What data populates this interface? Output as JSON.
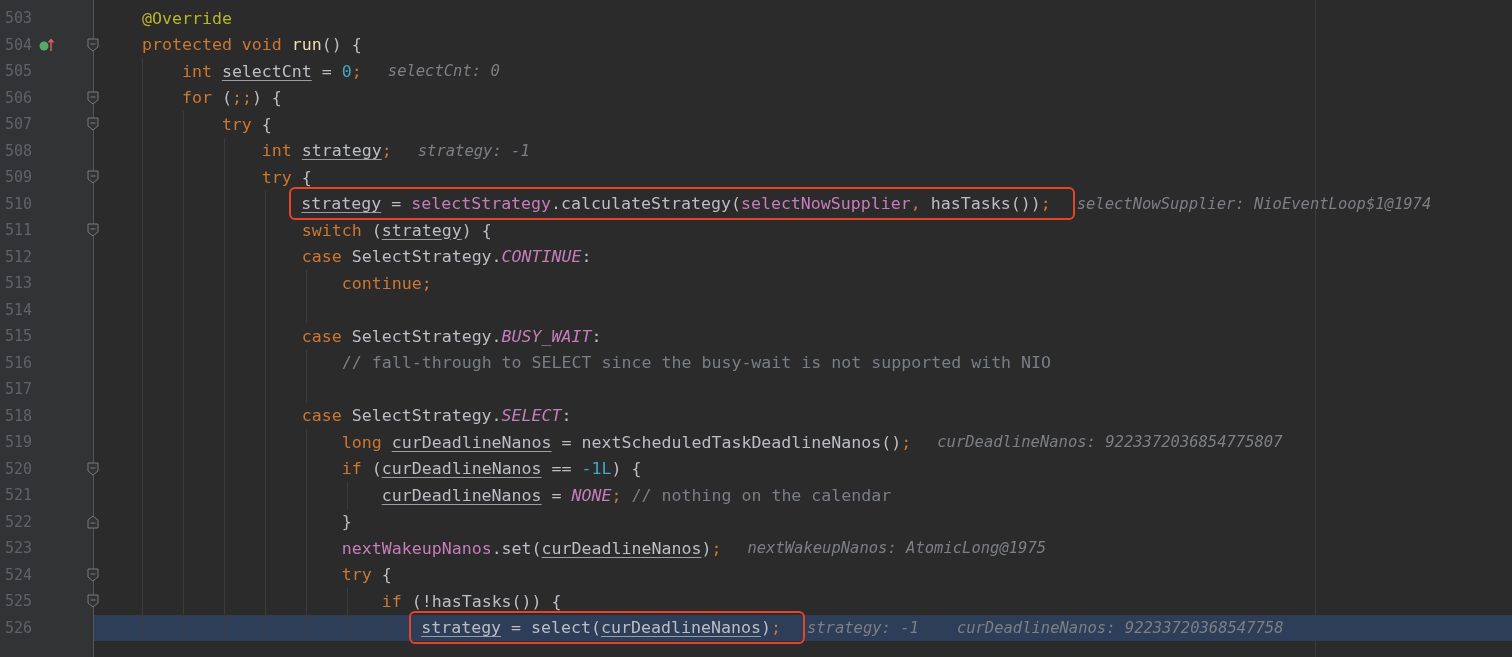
{
  "editor": {
    "lines": [
      {
        "number": "503",
        "tokens": [
          {
            "kind": "annotation",
            "text": "@Override"
          }
        ]
      },
      {
        "number": "504",
        "override_marker": true,
        "fold_start": true,
        "tokens": [
          {
            "kind": "keyword",
            "text": "protected void "
          },
          {
            "kind": "decl",
            "text": "run"
          },
          {
            "kind": "plain",
            "text": "() {"
          }
        ]
      },
      {
        "number": "505",
        "tokens": [
          {
            "kind": "keyword",
            "text": "int "
          },
          {
            "kind": "local",
            "text": "selectCnt"
          },
          {
            "kind": "plain",
            "text": " = "
          },
          {
            "kind": "number",
            "text": "0"
          },
          {
            "kind": "punct",
            "text": ";"
          }
        ],
        "hints": [
          "selectCnt: 0"
        ]
      },
      {
        "number": "506",
        "fold_start": true,
        "tokens": [
          {
            "kind": "keyword",
            "text": "for "
          },
          {
            "kind": "plain",
            "text": "("
          },
          {
            "kind": "punct",
            "text": ";;"
          },
          {
            "kind": "plain",
            "text": ") {"
          }
        ]
      },
      {
        "number": "507",
        "fold_start": true,
        "tokens": [
          {
            "kind": "keyword",
            "text": "try "
          },
          {
            "kind": "plain",
            "text": "{"
          }
        ]
      },
      {
        "number": "508",
        "tokens": [
          {
            "kind": "keyword",
            "text": "int "
          },
          {
            "kind": "local",
            "text": "strategy"
          },
          {
            "kind": "punct",
            "text": ";"
          }
        ],
        "hints": [
          "strategy: -1"
        ]
      },
      {
        "number": "509",
        "fold_start": true,
        "tokens": [
          {
            "kind": "keyword",
            "text": "try "
          },
          {
            "kind": "plain",
            "text": "{"
          }
        ]
      },
      {
        "number": "510",
        "boxed": true,
        "tokens": [
          {
            "kind": "local",
            "text": "strategy"
          },
          {
            "kind": "plain",
            "text": " = "
          },
          {
            "kind": "field",
            "text": "selectStrategy"
          },
          {
            "kind": "plain",
            "text": ".calculateStrategy("
          },
          {
            "kind": "field",
            "text": "selectNowSupplier"
          },
          {
            "kind": "punct",
            "text": ", "
          },
          {
            "kind": "plain",
            "text": "hasTasks())"
          },
          {
            "kind": "punct",
            "text": ";"
          }
        ],
        "hints": [
          "selectNowSupplier: NioEventLoop$1@1974"
        ]
      },
      {
        "number": "511",
        "fold_start": true,
        "tokens": [
          {
            "kind": "keyword",
            "text": "switch "
          },
          {
            "kind": "plain",
            "text": "("
          },
          {
            "kind": "local",
            "text": "strategy"
          },
          {
            "kind": "plain",
            "text": ") {"
          }
        ]
      },
      {
        "number": "512",
        "tokens": [
          {
            "kind": "keyword",
            "text": "case "
          },
          {
            "kind": "plain",
            "text": "SelectStrategy."
          },
          {
            "kind": "constant",
            "text": "CONTINUE"
          },
          {
            "kind": "plain",
            "text": ":"
          }
        ]
      },
      {
        "number": "513",
        "tokens": [
          {
            "kind": "keyword",
            "text": "continue"
          },
          {
            "kind": "punct",
            "text": ";"
          }
        ]
      },
      {
        "number": "514"
      },
      {
        "number": "515",
        "tokens": [
          {
            "kind": "keyword",
            "text": "case "
          },
          {
            "kind": "plain",
            "text": "SelectStrategy."
          },
          {
            "kind": "constant",
            "text": "BUSY_WAIT"
          },
          {
            "kind": "plain",
            "text": ":"
          }
        ]
      },
      {
        "number": "516",
        "tokens": [
          {
            "kind": "comment",
            "text": "// fall-through to SELECT since the busy-wait is not supported with NIO"
          }
        ]
      },
      {
        "number": "517"
      },
      {
        "number": "518",
        "tokens": [
          {
            "kind": "keyword",
            "text": "case "
          },
          {
            "kind": "plain",
            "text": "SelectStrategy."
          },
          {
            "kind": "constant",
            "text": "SELECT"
          },
          {
            "kind": "plain",
            "text": ":"
          }
        ]
      },
      {
        "number": "519",
        "tokens": [
          {
            "kind": "keyword",
            "text": "long "
          },
          {
            "kind": "local",
            "text": "curDeadlineNanos"
          },
          {
            "kind": "plain",
            "text": " = nextScheduledTaskDeadlineNanos()"
          },
          {
            "kind": "punct",
            "text": ";"
          }
        ],
        "hints": [
          "curDeadlineNanos: 9223372036854775807"
        ]
      },
      {
        "number": "520",
        "fold_start": true,
        "tokens": [
          {
            "kind": "keyword",
            "text": "if "
          },
          {
            "kind": "plain",
            "text": "("
          },
          {
            "kind": "local",
            "text": "curDeadlineNanos"
          },
          {
            "kind": "plain",
            "text": " == "
          },
          {
            "kind": "number",
            "text": "-1L"
          },
          {
            "kind": "plain",
            "text": ") {"
          }
        ]
      },
      {
        "number": "521",
        "tokens": [
          {
            "kind": "local",
            "text": "curDeadlineNanos"
          },
          {
            "kind": "plain",
            "text": " = "
          },
          {
            "kind": "constant",
            "text": "NONE"
          },
          {
            "kind": "punct",
            "text": ";"
          },
          {
            "kind": "comment",
            "text": " // nothing on the calendar"
          }
        ]
      },
      {
        "number": "522",
        "fold_end": true,
        "tokens": [
          {
            "kind": "plain",
            "text": "}"
          }
        ]
      },
      {
        "number": "523",
        "tokens": [
          {
            "kind": "field",
            "text": "nextWakeupNanos"
          },
          {
            "kind": "plain",
            "text": ".set("
          },
          {
            "kind": "local",
            "text": "curDeadlineNanos"
          },
          {
            "kind": "plain",
            "text": ")"
          },
          {
            "kind": "punct",
            "text": ";"
          }
        ],
        "hints": [
          "nextWakeupNanos: AtomicLong@1975"
        ]
      },
      {
        "number": "524",
        "fold_start": true,
        "tokens": [
          {
            "kind": "keyword",
            "text": "try "
          },
          {
            "kind": "plain",
            "text": "{"
          }
        ]
      },
      {
        "number": "525",
        "fold_start": true,
        "tokens": [
          {
            "kind": "keyword",
            "text": "if "
          },
          {
            "kind": "plain",
            "text": "(!hasTasks()) {"
          }
        ]
      },
      {
        "number": "526",
        "current": true,
        "boxed": true,
        "tokens": [
          {
            "kind": "local",
            "text": "strategy"
          },
          {
            "kind": "plain",
            "text": " = select("
          },
          {
            "kind": "local",
            "text": "curDeadlineNanos"
          },
          {
            "kind": "plain",
            "text": ")"
          },
          {
            "kind": "punct",
            "text": ";"
          }
        ],
        "hints": [
          "strategy: -1",
          "curDeadlineNanos: 92233720368547758"
        ]
      }
    ]
  }
}
